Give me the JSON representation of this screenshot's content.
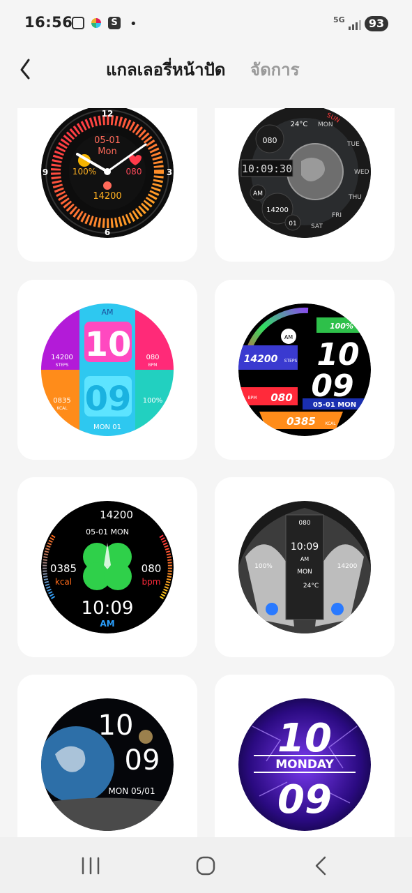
{
  "status_bar": {
    "time": "16:56",
    "network": "5G",
    "battery": "93"
  },
  "header": {
    "title": "แกลเลอรี่หน้าปัด",
    "manage_label": "จัดการ"
  },
  "faces": [
    {
      "id": "face-1",
      "date": "05-01",
      "day": "Mon",
      "battery": "100%",
      "heart": "080",
      "steps": "14200",
      "n12": "12",
      "n3": "3",
      "n6": "6",
      "n9": "9"
    },
    {
      "id": "face-2",
      "temp": "24°C",
      "heart": "080",
      "time": "10:09:30",
      "ampm": "AM",
      "steps": "14200",
      "date": "01",
      "days": [
        "SUN",
        "MON",
        "TUE",
        "WED",
        "THU",
        "FRI",
        "SAT"
      ]
    },
    {
      "id": "face-3",
      "ampm": "AM",
      "hour": "10",
      "minute": "09",
      "steps": "14200",
      "steps_label": "STEPS",
      "bpm": "080",
      "bpm_label": "BPM",
      "kcal": "0835",
      "kcal_label": "KCAL",
      "battery": "100%",
      "date": "MON  01"
    },
    {
      "id": "face-4",
      "ampm": "AM",
      "battery": "100%",
      "hour": "10",
      "minute": "09",
      "steps": "14200",
      "steps_label": "STEPS",
      "bpm_label": "BPM",
      "bpm": "080",
      "date": "05-01 MON",
      "kcal": "0385",
      "kcal_label": "KCAL"
    },
    {
      "id": "face-5",
      "steps": "14200",
      "date": "05-01   MON",
      "kcal": "0385",
      "kcal_label": "kcal",
      "bpm": "080",
      "bpm_label": "bpm",
      "time": "10:09",
      "ampm": "AM"
    },
    {
      "id": "face-6",
      "heart": "080",
      "time": "10:09",
      "ampm": "AM",
      "day": "MON",
      "temp": "24°C",
      "battery": "100%",
      "steps": "14200"
    },
    {
      "id": "face-7",
      "hour": "10",
      "minute": "09",
      "date": "MON  05/01"
    },
    {
      "id": "face-8",
      "hour": "10",
      "day": "MONDAY",
      "minute": "09"
    }
  ],
  "colors": {
    "background": "#f5f5f5",
    "card": "#ffffff",
    "title": "#1a1a1a",
    "manage": "#9a9a9a"
  }
}
